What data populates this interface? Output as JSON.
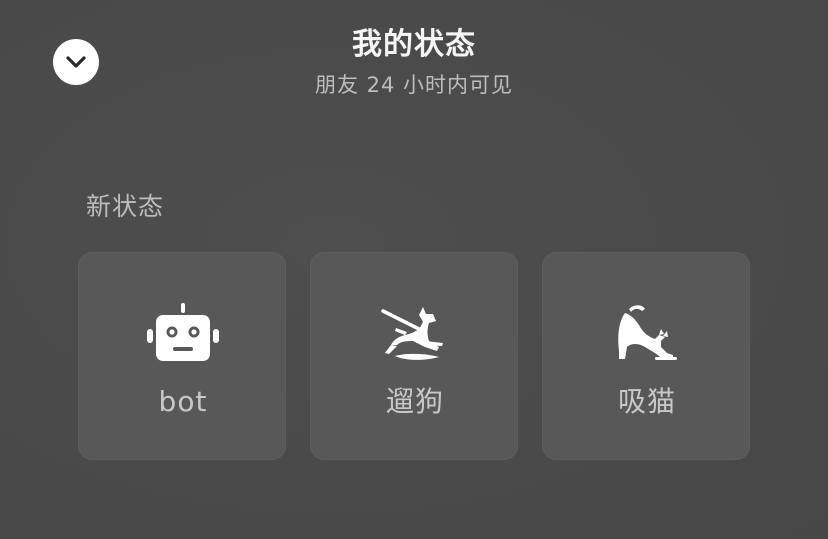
{
  "header": {
    "title": "我的状态",
    "subtitle": "朋友 24 小时内可见"
  },
  "collapse_button": {
    "icon": "chevron-down-icon"
  },
  "section": {
    "label": "新状态"
  },
  "cards": [
    {
      "label": "bot",
      "icon": "robot-icon"
    },
    {
      "label": "遛狗",
      "icon": "dog-walking-icon"
    },
    {
      "label": "吸猫",
      "icon": "cat-stretch-icon"
    }
  ],
  "colors": {
    "background": "#4a4a4a",
    "card": "#585858",
    "title": "#f5f5f5",
    "subtitle": "#bdbdbd",
    "label": "#c8c8c8"
  }
}
